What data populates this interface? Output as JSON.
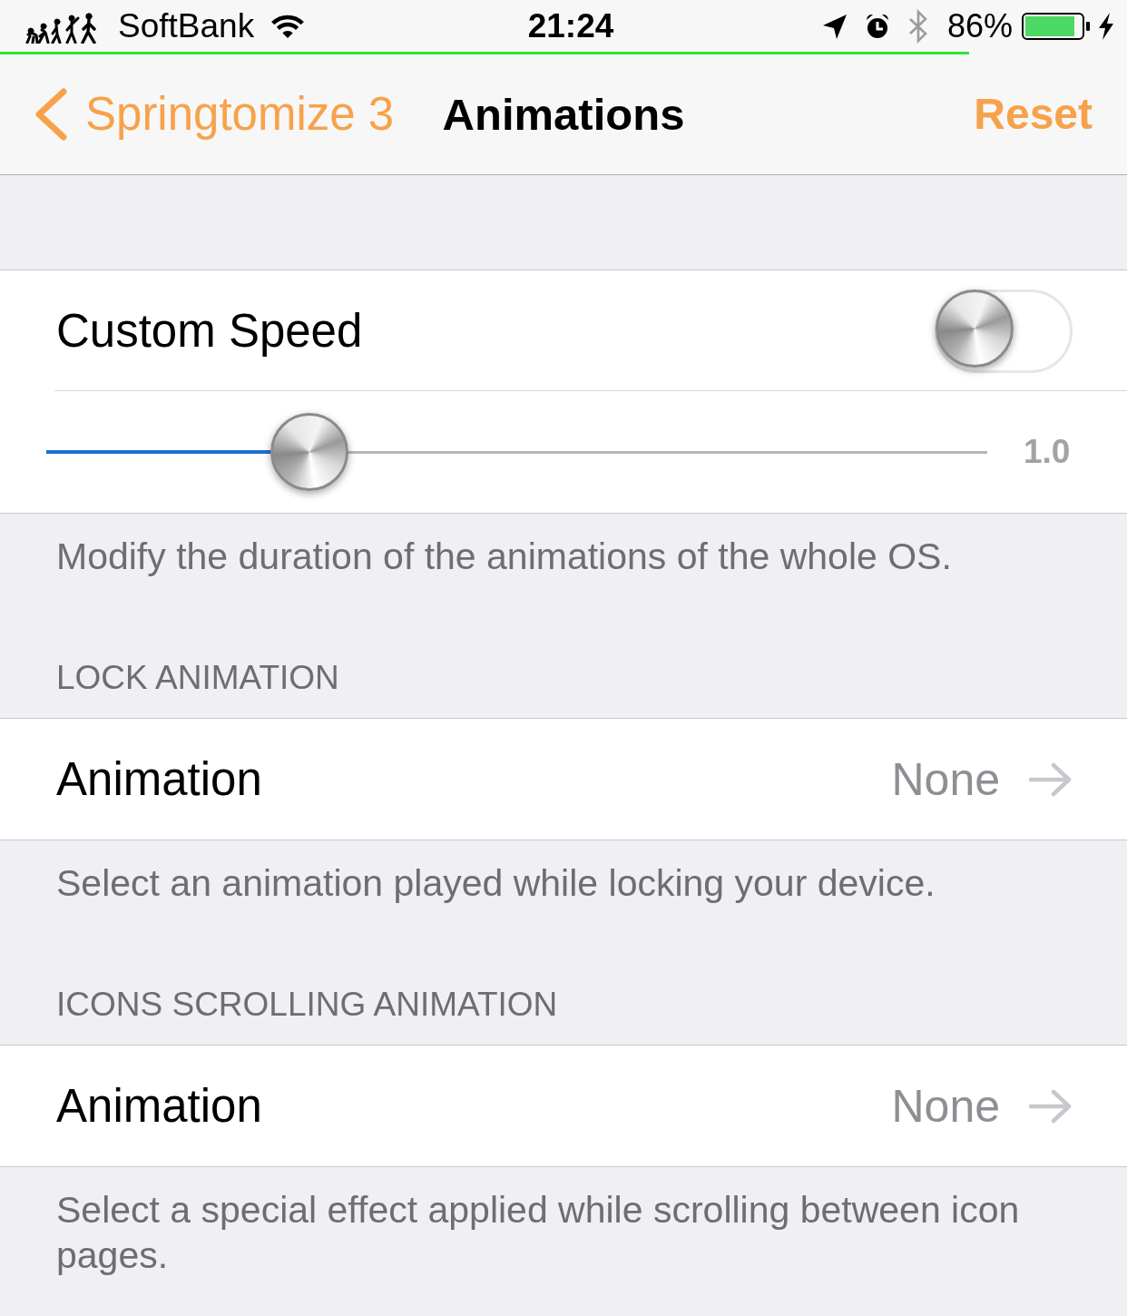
{
  "status_bar": {
    "carrier": "SoftBank",
    "time": "21:24",
    "battery_percent": "86%",
    "battery_line": {
      "level": 0.86
    }
  },
  "nav_bar": {
    "back_label": "Springtomize 3",
    "title": "Animations",
    "action": "Reset"
  },
  "sections": [
    {
      "rows": [
        {
          "kind": "switch",
          "label": "Custom Speed",
          "on": false
        },
        {
          "kind": "slider",
          "level": 0.28,
          "reading": "1.0"
        }
      ],
      "footer": "Modify the duration of the animations of the whole OS."
    },
    {
      "header": "LOCK ANIMATION",
      "rows": [
        {
          "kind": "link",
          "label": "Animation",
          "value": "None"
        }
      ],
      "footer": "Select an animation played while locking your device."
    },
    {
      "header": "ICONS SCROLLING ANIMATION",
      "rows": [
        {
          "kind": "link",
          "label": "Animation",
          "value": "None"
        }
      ],
      "footer": "Select a special effect applied while scrolling between icon pages."
    }
  ]
}
